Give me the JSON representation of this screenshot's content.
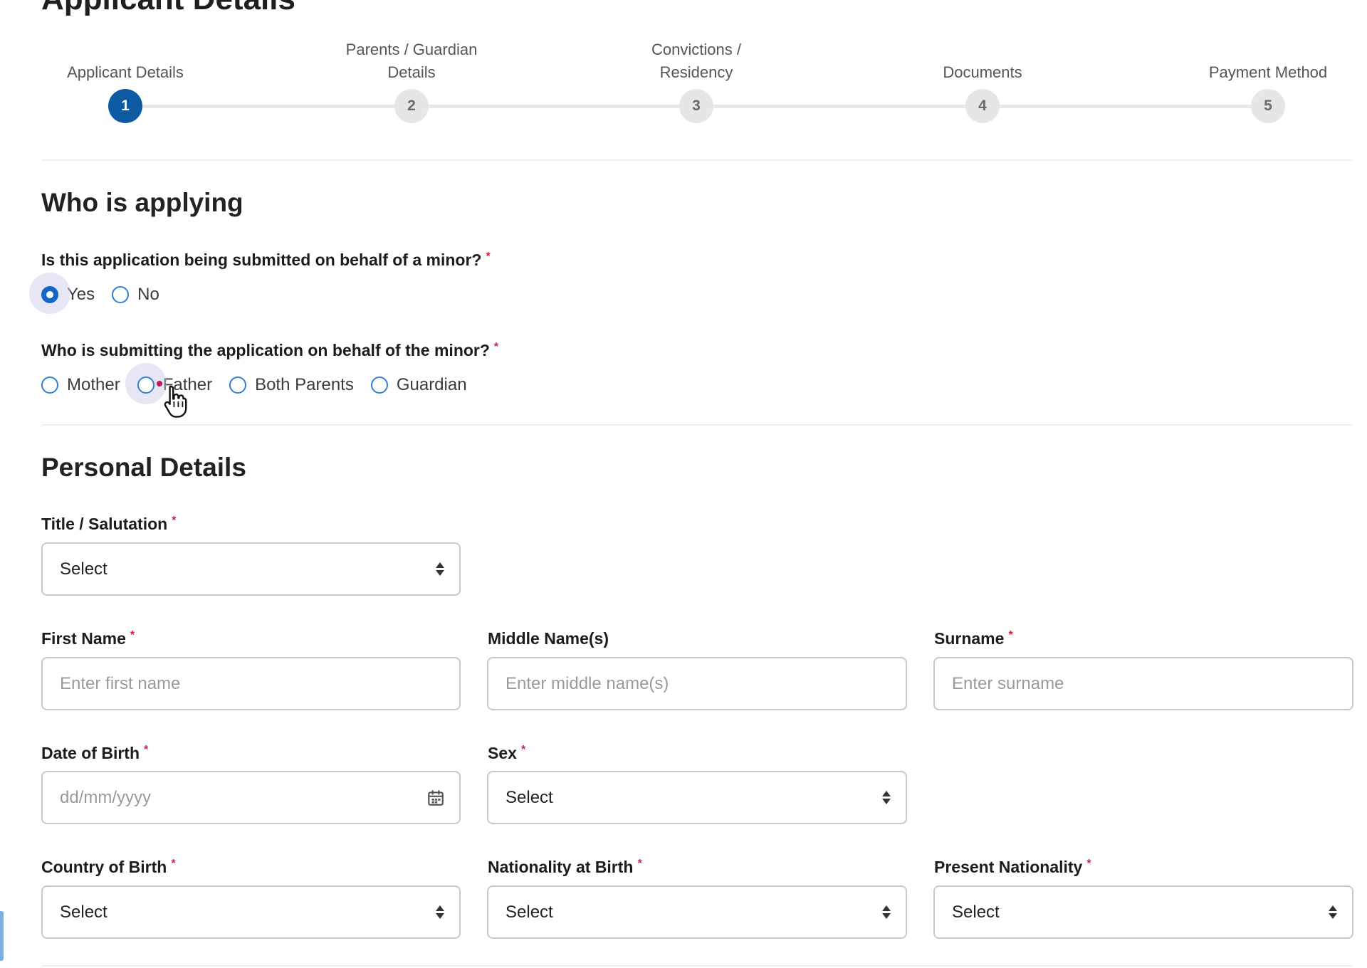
{
  "page": {
    "title": "Applicant Details"
  },
  "stepper": {
    "steps": [
      {
        "label_line1": "Applicant Details",
        "label_line2": "",
        "number": "1",
        "active": true
      },
      {
        "label_line1": "Parents / Guardian",
        "label_line2": "Details",
        "number": "2",
        "active": false
      },
      {
        "label_line1": "Convictions /",
        "label_line2": "Residency",
        "number": "3",
        "active": false
      },
      {
        "label_line1": "Documents",
        "label_line2": "",
        "number": "4",
        "active": false
      },
      {
        "label_line1": "Payment Method",
        "label_line2": "",
        "number": "5",
        "active": false
      }
    ]
  },
  "who_is_applying": {
    "heading": "Who is applying",
    "minor_question": "Is this application being submitted on behalf of a minor?",
    "minor_options": [
      "Yes",
      "No"
    ],
    "minor_selected": "Yes",
    "submitter_question": "Who is submitting the application on behalf of the minor?",
    "submitter_options": [
      "Mother",
      "Father",
      "Both Parents",
      "Guardian"
    ]
  },
  "personal_details": {
    "heading": "Personal Details",
    "title_label": "Title / Salutation",
    "title_value": "Select",
    "first_name_label": "First Name",
    "first_name_placeholder": "Enter first name",
    "middle_name_label": "Middle Name(s)",
    "middle_name_placeholder": "Enter middle name(s)",
    "surname_label": "Surname",
    "surname_placeholder": "Enter surname",
    "dob_label": "Date of Birth",
    "dob_placeholder": "dd/mm/yyyy",
    "sex_label": "Sex",
    "sex_value": "Select",
    "country_of_birth_label": "Country of Birth",
    "country_of_birth_value": "Select",
    "nationality_at_birth_label": "Nationality at Birth",
    "nationality_at_birth_value": "Select",
    "present_nationality_label": "Present Nationality",
    "present_nationality_value": "Select"
  },
  "required_marker": "*",
  "colors": {
    "accent": "#0f5ba3",
    "radio": "#2f7fd8",
    "required": "#d4203a"
  }
}
